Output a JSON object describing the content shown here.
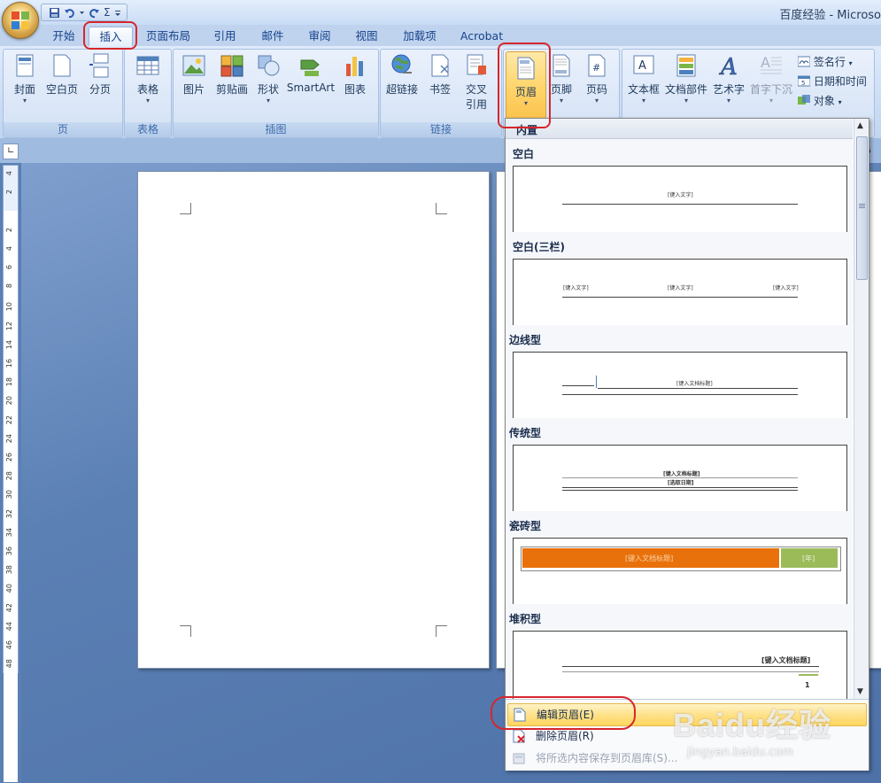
{
  "window": {
    "title": "百度经验 - Microso"
  },
  "qat": {
    "sigma": "Σ"
  },
  "tabs": [
    {
      "label": "开始"
    },
    {
      "label": "插入"
    },
    {
      "label": "页面布局"
    },
    {
      "label": "引用"
    },
    {
      "label": "邮件"
    },
    {
      "label": "审阅"
    },
    {
      "label": "视图"
    },
    {
      "label": "加载项"
    },
    {
      "label": "Acrobat"
    }
  ],
  "active_tab": "插入",
  "groups": {
    "page": {
      "label": "页",
      "buttons": [
        "封面",
        "空白页",
        "分页"
      ]
    },
    "table": {
      "label": "表格",
      "buttons": [
        "表格"
      ]
    },
    "illustrations": {
      "label": "插图",
      "buttons": [
        "图片",
        "剪贴画",
        "形状",
        "SmartArt",
        "图表"
      ]
    },
    "links": {
      "label": "链接",
      "buttons": [
        "超链接",
        "书签",
        "交叉",
        "引用"
      ]
    },
    "header_footer": {
      "buttons": [
        "页眉",
        "页脚",
        "页码"
      ]
    },
    "text": {
      "buttons": [
        "文本框",
        "文档部件",
        "艺术字",
        "首字下沉"
      ],
      "small": [
        "签名行",
        "日期和时间",
        "对象"
      ]
    }
  },
  "vruler_numbers": [
    "4",
    "2",
    "",
    "2",
    "4",
    "6",
    "8",
    "10",
    "12",
    "14",
    "16",
    "18",
    "20",
    "22",
    "24",
    "26",
    "28",
    "30",
    "32",
    "34",
    "36",
    "38",
    "40",
    "42",
    "44",
    "46",
    "48"
  ],
  "ruler_right_number": "6",
  "dropdown": {
    "category": "内置",
    "sections": [
      {
        "title": "空白",
        "texts": [
          "[键入文字]"
        ]
      },
      {
        "title": "空白(三栏)",
        "texts": [
          "[键入文字]",
          "[键入文字]",
          "[键入文字]"
        ]
      },
      {
        "title": "边线型",
        "texts": [
          "[键入文档标题]"
        ]
      },
      {
        "title": "传统型",
        "texts": [
          "[键入文档标题]",
          "[选取日期]"
        ]
      },
      {
        "title": "瓷砖型",
        "texts": [
          "[键入文档标题]",
          "[年]"
        ]
      },
      {
        "title": "堆积型",
        "texts": [
          "[键入文档标题]",
          "1"
        ]
      }
    ],
    "menu": [
      {
        "label": "编辑页眉(E)"
      },
      {
        "label": "删除页眉(R)"
      },
      {
        "label": "将所选内容保存到页眉库(S)..."
      }
    ]
  },
  "watermark": {
    "logo": "Baidu经验",
    "url": "jingyan.baidu.com"
  },
  "colors": {
    "accent": "#d6262c",
    "tile_orange": "#e8710b",
    "tile_green": "#9bbb59",
    "highlight": "#ffd65d"
  }
}
